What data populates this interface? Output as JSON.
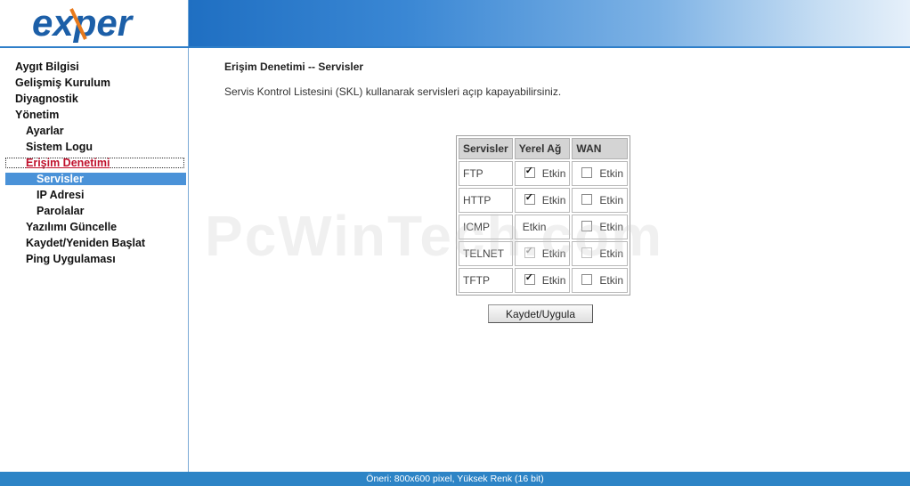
{
  "header": {
    "logo_text": "exper"
  },
  "sidebar": {
    "items": [
      {
        "label": "Aygıt Bilgisi"
      },
      {
        "label": "Gelişmiş Kurulum"
      },
      {
        "label": "Diyagnostik"
      },
      {
        "label": "Yönetim"
      },
      {
        "label": "Ayarlar"
      },
      {
        "label": "Sistem Logu"
      },
      {
        "label": "Erişim Denetimi"
      },
      {
        "label": "Servisler"
      },
      {
        "label": "IP Adresi"
      },
      {
        "label": "Parolalar"
      },
      {
        "label": "Yazılımı Güncelle"
      },
      {
        "label": "Kaydet/Yeniden Başlat"
      },
      {
        "label": "Ping Uygulaması"
      }
    ]
  },
  "main": {
    "title": "Erişim Denetimi -- Servisler",
    "description": "Servis Kontrol Listesini (SKL) kullanarak servisleri açıp kapayabilirsiniz.",
    "table": {
      "headers": [
        "Servisler",
        "Yerel Ağ",
        "WAN"
      ],
      "rows": [
        {
          "service": "FTP",
          "lan": "Etkin",
          "wan": "Etkin"
        },
        {
          "service": "HTTP",
          "lan": "Etkin",
          "wan": "Etkin"
        },
        {
          "service": "ICMP",
          "lan": "Etkin",
          "wan": "Etkin"
        },
        {
          "service": "TELNET",
          "lan": "Etkin",
          "wan": "Etkin"
        },
        {
          "service": "TFTP",
          "lan": "Etkin",
          "wan": "Etkin"
        }
      ]
    },
    "save_label": "Kaydet/Uygula"
  },
  "watermark": "PcWinTech.com",
  "footer": {
    "text": "Öneri: 800x600 pixel, Yüksek Renk (16 bit)"
  },
  "colors": {
    "accent": "#2d84c6",
    "active_link": "#c0102c",
    "selected_bg": "#4a92d8"
  }
}
